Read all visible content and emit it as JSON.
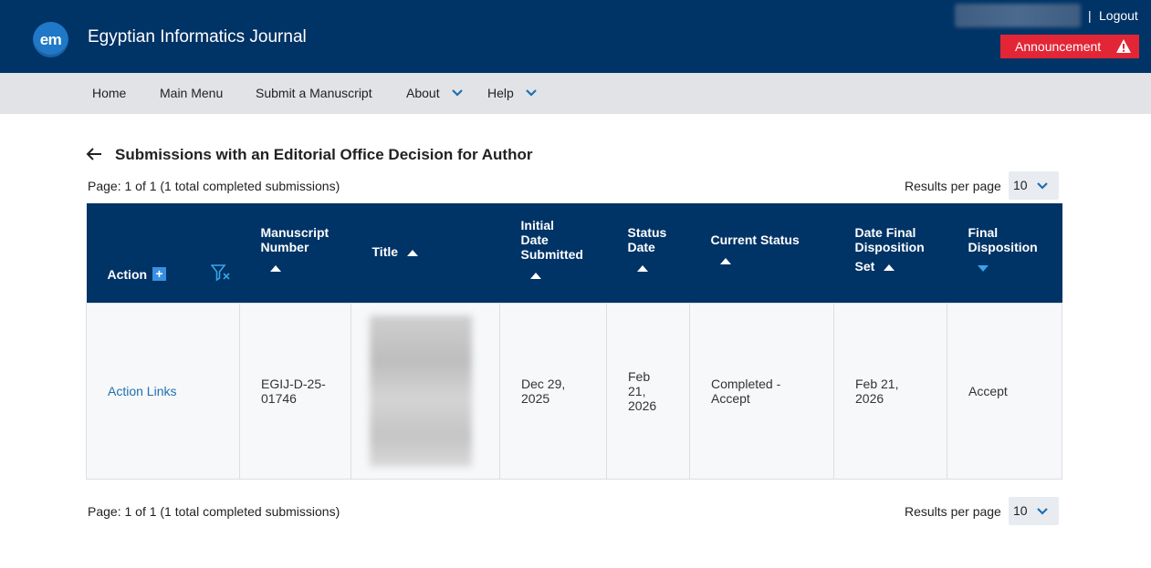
{
  "header": {
    "logo_text": "em",
    "journal_title": "Egyptian Informatics Journal",
    "separator": "|",
    "logout_label": "Logout",
    "announcement_label": "Announcement",
    "announcement_icon": "warning-triangle-icon"
  },
  "nav": {
    "items": [
      {
        "label": "Home"
      },
      {
        "label": "Main Menu"
      },
      {
        "label": "Submit a Manuscript"
      },
      {
        "label": "About"
      },
      {
        "label": "Help"
      }
    ]
  },
  "page": {
    "title": "Submissions with an Editorial Office Decision for Author",
    "pager_top": "Page: 1 of 1 (1 total completed submissions)",
    "pager_bottom": "Page: 1 of 1 (1 total completed submissions)",
    "results_per_page_label": "Results per page",
    "results_per_page_value": "10"
  },
  "table": {
    "headers": {
      "action": "Action",
      "manuscript_number_1": "Manuscript",
      "manuscript_number_2": "Number",
      "title": "Title",
      "initial_1": "Initial",
      "initial_2": "Date",
      "initial_3": "Submitted",
      "status_date_1": "Status",
      "status_date_2": "Date",
      "current_status": "Current Status",
      "date_final_1": "Date Final",
      "date_final_2": "Disposition",
      "date_final_3": "Set",
      "final_disp_1": "Final",
      "final_disp_2": "Disposition"
    },
    "rows": [
      {
        "action": "Action Links",
        "manuscript_1": "EGIJ-D-25-",
        "manuscript_2": "01746",
        "initial_1": "Dec 29,",
        "initial_2": "2025",
        "status_date_1": "Feb",
        "status_date_2": "21,",
        "status_date_3": "2026",
        "current_1": "Completed -",
        "current_2": "Accept",
        "final_date_1": "Feb 21,",
        "final_date_2": "2026",
        "final_disposition": "Accept"
      }
    ]
  },
  "colors": {
    "header_bg": "#003366",
    "nav_bg": "#e1e3e6",
    "announcement_bg": "#e32636",
    "link": "#1f6fb2"
  }
}
